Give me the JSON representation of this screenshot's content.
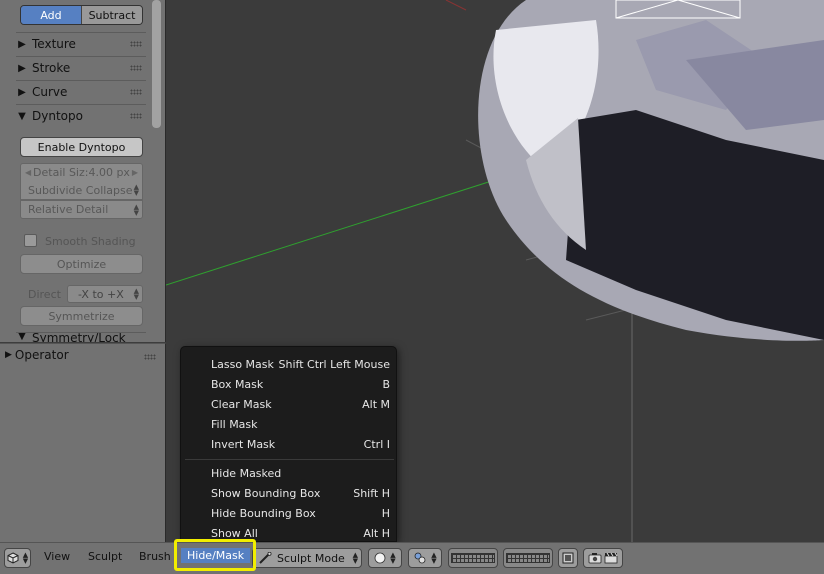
{
  "tool_panel": {
    "add_label": "Add",
    "subtract_label": "Subtract",
    "sections": [
      {
        "label": "Texture",
        "expanded": false
      },
      {
        "label": "Stroke",
        "expanded": false
      },
      {
        "label": "Curve",
        "expanded": false
      },
      {
        "label": "Dyntopo",
        "expanded": true
      }
    ],
    "enable_dyntopo_label": "Enable Dyntopo",
    "detail_size_label": "Detail Siz:4.00 px",
    "subdivide_collapse_label": "Subdivide Collapse",
    "relative_detail_label": "Relative Detail",
    "smooth_shading_label": "Smooth Shading",
    "optimize_label": "Optimize",
    "direct_label": "Direct",
    "direct_value": "-X to +X",
    "symmetrize_label": "Symmetrize",
    "next_section_label": "Symmetry/Lock"
  },
  "operator_panel": {
    "title": "Operator"
  },
  "hide_mask_menu": {
    "items": [
      {
        "label": "Lasso Mask",
        "shortcut": "Shift Ctrl Left Mouse"
      },
      {
        "label": "Box Mask",
        "shortcut": "B"
      },
      {
        "label": "Clear Mask",
        "shortcut": "Alt M"
      },
      {
        "label": "Fill Mask",
        "shortcut": ""
      },
      {
        "label": "Invert Mask",
        "shortcut": "Ctrl I"
      },
      {
        "label": "Hide Masked",
        "shortcut": ""
      },
      {
        "label": "Show Bounding Box",
        "shortcut": "Shift H"
      },
      {
        "label": "Hide Bounding Box",
        "shortcut": "H"
      },
      {
        "label": "Show All",
        "shortcut": "Alt H"
      }
    ]
  },
  "header": {
    "menus": [
      "View",
      "Sculpt",
      "Brush",
      "Hide/Mask"
    ],
    "active_menu": "Hide/Mask",
    "mode_label": "Sculpt Mode"
  },
  "colors": {
    "accent": "#5680c2",
    "highlight_box": "#f2ee00",
    "menu_bg": "#1c1c1c"
  },
  "icons": [
    "cube-editor-icon",
    "brush-icon",
    "sphere-shading-icon",
    "pivot-icon",
    "layers-grid-icon",
    "render-icon",
    "camera-icon",
    "clapper-icon"
  ]
}
